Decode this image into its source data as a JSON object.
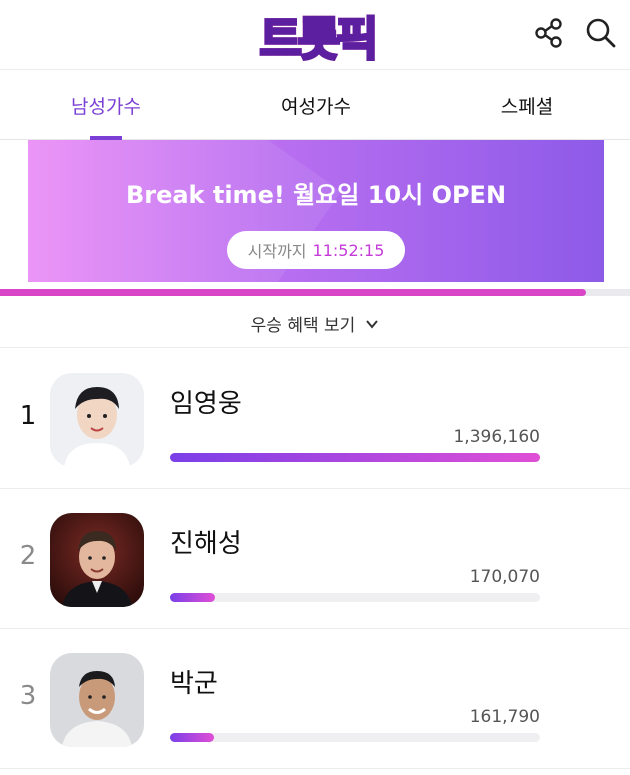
{
  "header": {
    "logo_text": "트롯픽",
    "icons": [
      "share-icon",
      "search-icon"
    ]
  },
  "tabs": [
    {
      "label": "남성가수",
      "active": true
    },
    {
      "label": "여성가수",
      "active": false
    },
    {
      "label": "스페셜",
      "active": false
    }
  ],
  "banner": {
    "title": "Break time! 월요일 10시 OPEN",
    "countdown_label": "시작까지",
    "countdown_time": "11:52:15"
  },
  "progress": {
    "fraction": 0.93
  },
  "benefits": {
    "label": "우승 혜택 보기",
    "icon": "chevron-down-icon"
  },
  "rankings": [
    {
      "rank": "1",
      "name": "임영웅",
      "votes": "1,396,160",
      "fraction": 1.0
    },
    {
      "rank": "2",
      "name": "진해성",
      "votes": "170,070",
      "fraction": 0.122
    },
    {
      "rank": "3",
      "name": "박군",
      "votes": "161,790",
      "fraction": 0.116
    }
  ],
  "colors": {
    "accent": "#7b3fd6",
    "countdown": "#c43bd8",
    "bar_start": "#7a3fe8",
    "bar_end": "#e04fd6"
  }
}
